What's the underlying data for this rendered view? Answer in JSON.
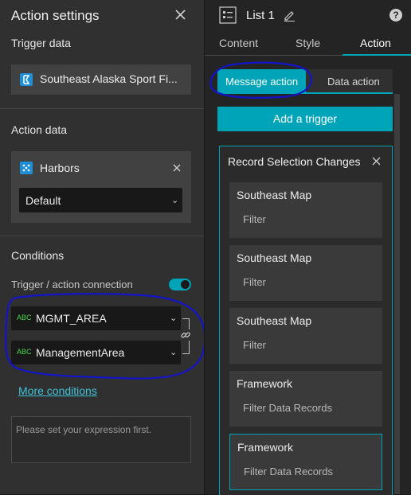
{
  "left_panel": {
    "title": "Action settings",
    "trigger_data": {
      "heading": "Trigger data",
      "source": "Southeast Alaska Sport Fi..."
    },
    "action_data": {
      "heading": "Action data",
      "layer": "Harbors",
      "view": "Default"
    },
    "conditions": {
      "heading": "Conditions",
      "toggle_label": "Trigger / action connection",
      "toggle_on": true,
      "field_type": "ABC",
      "trigger_field": "MGMT_AREA",
      "action_field": "ManagementArea",
      "more_link": "More conditions",
      "expression_placeholder": "Please set your expression first."
    }
  },
  "right_panel": {
    "widget_title": "List 1",
    "tabs": [
      "Content",
      "Style",
      "Action"
    ],
    "active_tab": "Action",
    "sub_tabs": [
      "Message action",
      "Data action"
    ],
    "active_sub_tab": "Message action",
    "add_trigger": "Add a trigger",
    "trigger_group": {
      "title": "Record Selection Changes",
      "actions": [
        {
          "target": "Southeast Map",
          "action": "Filter"
        },
        {
          "target": "Southeast Map",
          "action": "Filter"
        },
        {
          "target": "Southeast Map",
          "action": "Filter"
        },
        {
          "target": "Framework",
          "action": "Filter Data Records"
        },
        {
          "target": "Framework",
          "action": "Filter Data Records",
          "selected": true
        }
      ]
    }
  },
  "colors": {
    "accent": "#00a4b8",
    "link": "#3fc3d8",
    "field_type": "#4ad84a",
    "annotation": "#1414c8"
  },
  "icons": [
    "close-icon",
    "layer-icon",
    "points-icon",
    "chevron-down-icon",
    "link-icon",
    "list-widget-icon",
    "edit-icon",
    "help-icon"
  ]
}
